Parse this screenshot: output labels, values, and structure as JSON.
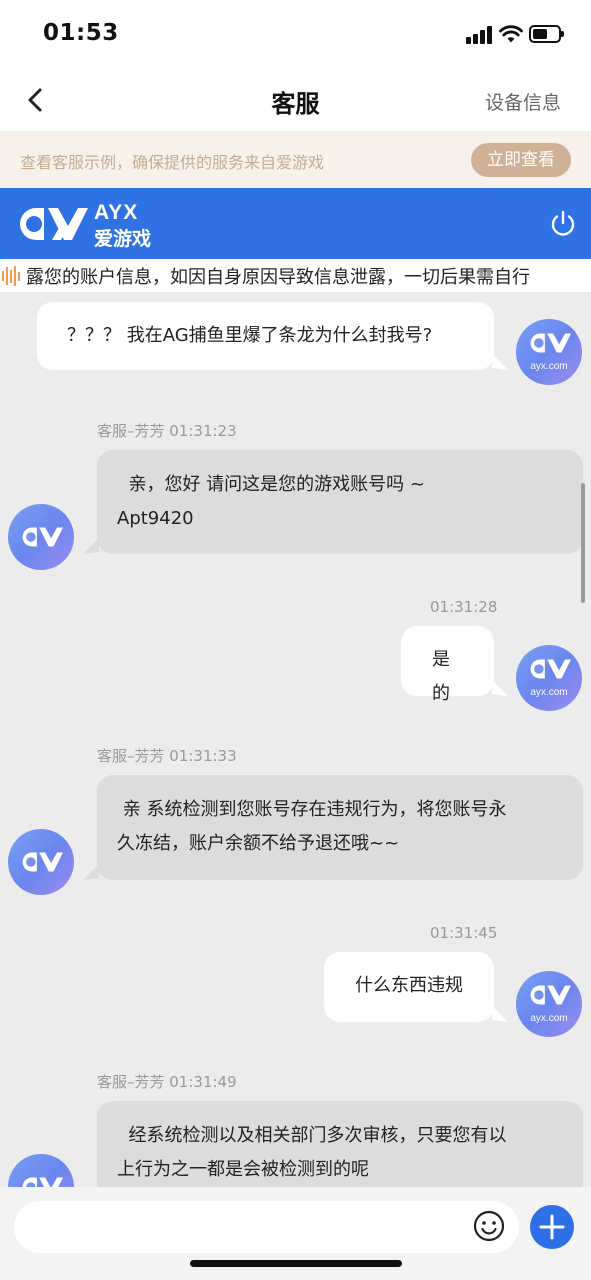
{
  "status": {
    "time": "01:53"
  },
  "nav": {
    "title": "客服",
    "right": "设备信息"
  },
  "notice": {
    "text": "查看客服示例，确保提供的服务来自爱游戏",
    "button": "立即查看"
  },
  "brand": {
    "en": "AYX",
    "cn": "爱游戏"
  },
  "marquee": {
    "text": "露您的账户信息，如因自身原因导致信息泄露，一切后果需自行"
  },
  "avatar_caption": "ayx.com",
  "messages": [
    {
      "from": "user",
      "text": "？？？ 我在AG捕鱼里爆了条龙为什么封我号?"
    },
    {
      "from": "agent",
      "meta": "客服–芳芳  01:31:23",
      "text": "  亲，您好 请问这是您的游戏账号吗 ~\nApt9420"
    },
    {
      "from": "user",
      "meta": "01:31:28",
      "text": "是的"
    },
    {
      "from": "agent",
      "meta": "客服–芳芳  01:31:33",
      "text": " 亲 系统检测到您账号存在违规行为，将您账号永\n久冻结，账户余额不给予退还哦~~"
    },
    {
      "from": "user",
      "meta": "01:31:45",
      "text": "什么东西违规"
    },
    {
      "from": "agent",
      "meta": "客服–芳芳  01:31:49",
      "text": "  经系统检测以及相关部门多次审核，只要您有以\n上行为之一都是会被检测到的呢"
    }
  ],
  "colors": {
    "brand_blue": "#2f72e4",
    "agent_bubble": "#dcdcdc",
    "notice_bg": "#f7f1ea",
    "notice_btn": "#cfb197",
    "plus_button": "#2f6fe6"
  }
}
